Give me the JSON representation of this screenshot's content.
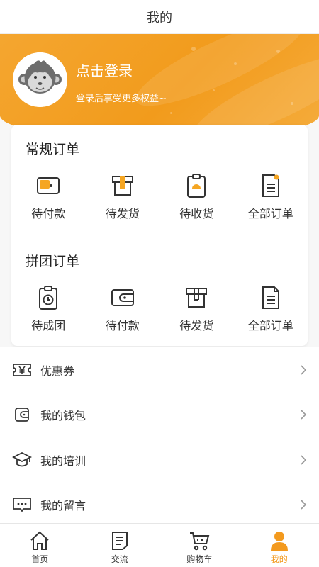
{
  "header": {
    "title": "我的"
  },
  "profile": {
    "login_title": "点击登录",
    "login_subtitle": "登录后享受更多权益~"
  },
  "regular_orders": {
    "title": "常规订单",
    "items": [
      {
        "label": "待付款",
        "icon": "wallet-icon"
      },
      {
        "label": "待发货",
        "icon": "box-icon"
      },
      {
        "label": "待收货",
        "icon": "clipboard-icon"
      },
      {
        "label": "全部订单",
        "icon": "document-icon"
      }
    ]
  },
  "group_orders": {
    "title": "拼团订单",
    "items": [
      {
        "label": "待成团",
        "icon": "clock-clipboard-icon"
      },
      {
        "label": "待付款",
        "icon": "wallet-icon"
      },
      {
        "label": "待发货",
        "icon": "box-icon"
      },
      {
        "label": "全部订单",
        "icon": "document-icon"
      }
    ]
  },
  "menu": {
    "items": [
      {
        "label": "优惠券",
        "icon": "coupon-icon"
      },
      {
        "label": "我的钱包",
        "icon": "wallet-icon"
      },
      {
        "label": "我的培训",
        "icon": "graduation-cap-icon"
      },
      {
        "label": "我的留言",
        "icon": "message-icon"
      }
    ]
  },
  "tabbar": {
    "items": [
      {
        "label": "首页",
        "icon": "home-icon"
      },
      {
        "label": "交流",
        "icon": "note-icon"
      },
      {
        "label": "购物车",
        "icon": "cart-icon"
      },
      {
        "label": "我的",
        "icon": "person-icon",
        "active": true
      }
    ]
  },
  "colors": {
    "accent": "#f39a1e",
    "text": "#333333",
    "background": "#f7f7f7"
  }
}
